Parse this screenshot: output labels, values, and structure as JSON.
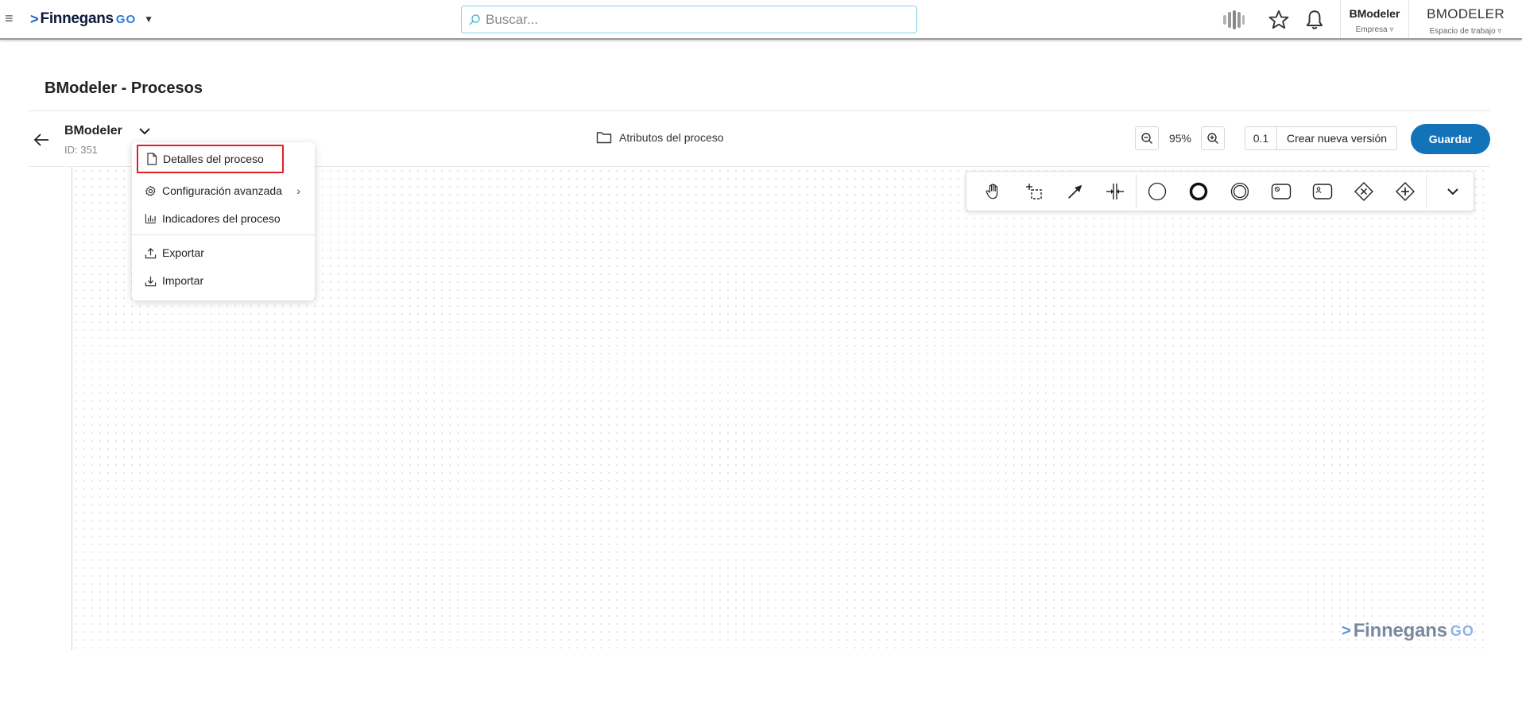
{
  "header": {
    "logo_text": "Finnegans",
    "logo_suffix": "GO",
    "search_placeholder": "Buscar...",
    "company_name": "BModeler",
    "company_label": "Empresa ▿",
    "workspace_name": "BMODELER",
    "workspace_label": "Espacio de trabajo ▿"
  },
  "page": {
    "title": "BModeler - Procesos"
  },
  "process": {
    "name": "BModeler",
    "id": "ID: 351",
    "attributes_label": "Atributos del proceso",
    "zoom": "95%",
    "version": "0.1",
    "new_version_label": "Crear nueva versión",
    "save_label": "Guardar"
  },
  "menu": {
    "items": [
      {
        "label": "Detalles del proceso",
        "icon": "document-icon"
      },
      {
        "label": "Configuración avanzada",
        "icon": "gear-icon"
      },
      {
        "label": "Indicadores del proceso",
        "icon": "bar-chart-icon"
      },
      {
        "label": "Exportar",
        "icon": "upload-icon"
      },
      {
        "label": "Importar",
        "icon": "download-icon"
      }
    ]
  },
  "toolbar": {
    "tools": [
      "hand-tool-icon",
      "lasso-tool-icon",
      "connect-tool-icon",
      "space-tool-icon",
      "start-event-icon",
      "end-event-icon",
      "intermediate-event-icon",
      "task-icon",
      "user-task-icon",
      "exclusive-gateway-icon",
      "parallel-gateway-icon",
      "more-chevron-icon"
    ]
  },
  "watermark": {
    "text": "Finnegans",
    "suffix": "GO"
  },
  "colors": {
    "primary": "#1273b8",
    "highlight_border": "#e01e24",
    "search_border": "#7fd3e6"
  }
}
